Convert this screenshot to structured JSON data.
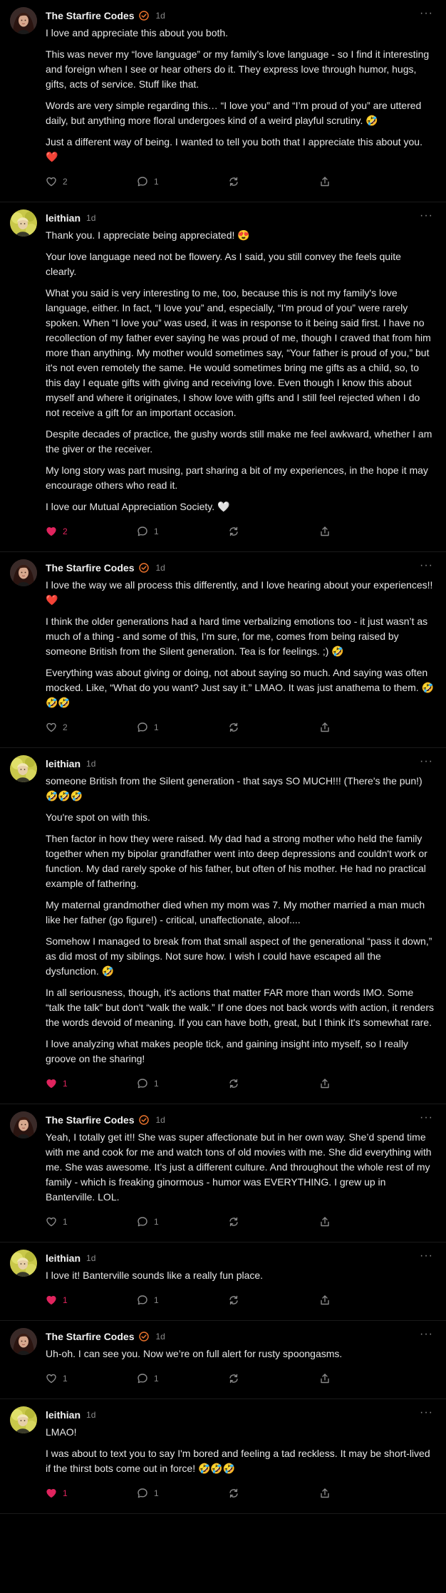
{
  "colors": {
    "background": "#000000",
    "text": "#e6e6e6",
    "muted": "#8a8a8a",
    "like": "#e0245e",
    "verified": "#e8722c"
  },
  "comments": [
    {
      "author": "The Starfire Codes",
      "verified": true,
      "avatar": "starfire",
      "time": "1d",
      "paragraphs": [
        "I love and appreciate this about you both.",
        "This was never my “love language” or my family’s love language - so I find it interesting and foreign when I see or hear others do it. They express love through humor, hugs, gifts, acts of service. Stuff like that.",
        "Words are very simple regarding this… “I love you” and “I’m proud of you” are uttered daily, but anything more floral undergoes kind of a weird playful scrutiny. 🤣",
        "Just a different way of being. I wanted to tell you both that I appreciate this about you. ❤️"
      ],
      "likes": "2",
      "liked": false,
      "replies": "1"
    },
    {
      "author": "leithian",
      "verified": false,
      "avatar": "leithian",
      "time": "1d",
      "paragraphs": [
        "Thank you. I appreciate being appreciated! 😍",
        "Your love language need not be flowery. As I said, you still convey the feels quite clearly.",
        "What you said is very interesting to me, too, because this is not my family's love language, either. In fact, “I love you” and, especially, “I'm proud of you” were rarely spoken. When “I love you” was used, it was in response to it being said first. I have no recollection of my father ever saying he was proud of me, though I craved that from him more than anything. My mother would sometimes say, “Your father is proud of you,” but it's not even remotely the same. He would sometimes bring me gifts as a child, so, to this day I equate gifts with giving and receiving love. Even though I know this about myself and where it originates, I show love with gifts and I still feel rejected when I do not receive a gift for an important occasion.",
        "Despite decades of practice, the gushy words still make me feel awkward, whether I am the giver or the receiver.",
        "My long story was part musing, part sharing a bit of my experiences, in the hope it may encourage others who read it.",
        "I love our Mutual Appreciation Society. 🤍"
      ],
      "likes": "2",
      "liked": true,
      "replies": "1"
    },
    {
      "author": "The Starfire Codes",
      "verified": true,
      "avatar": "starfire",
      "time": "1d",
      "paragraphs": [
        "I love the way we all process this differently, and I love hearing about your experiences!! ❤️",
        "I think the older generations had a hard time verbalizing emotions too - it just wasn’t as much of a thing - and some of this, I’m sure, for me, comes from being raised by someone British from the Silent generation. Tea is for feelings. ;) 🤣",
        "Everything was about giving or doing, not about saying so much. And saying was often mocked. Like, “What do you want? Just say it.” LMAO. It was just anathema to them. 🤣🤣🤣"
      ],
      "likes": "2",
      "liked": false,
      "replies": "1"
    },
    {
      "author": "leithian",
      "verified": false,
      "avatar": "leithian",
      "time": "1d",
      "paragraphs": [
        "someone British from the Silent generation - that says SO MUCH!!! (There's the pun!) 🤣🤣🤣",
        "You're spot on with this.",
        "Then factor in how they were raised. My dad had a strong mother who held the family together when my bipolar grandfather went into deep depressions and couldn't work or function. My dad rarely spoke of his father, but often of his mother. He had no practical example of fathering.",
        "My maternal grandmother died when my mom was 7. My mother married a man much like her father (go figure!) - critical, unaffectionate, aloof....",
        "Somehow I managed to break from that small aspect of the generational “pass it down,” as did most of my siblings. Not sure how. I wish I could have escaped all the dysfunction. 🤣",
        "In all seriousness, though, it's actions that matter FAR more than words IMO. Some “talk the talk” but don't “walk the walk.” If one does not back words with action, it renders the words devoid of meaning. If you can have both, great, but I think it's somewhat rare.",
        "I love analyzing what makes people tick, and gaining insight into myself, so I really groove on the sharing!"
      ],
      "likes": "1",
      "liked": true,
      "replies": "1"
    },
    {
      "author": "The Starfire Codes",
      "verified": true,
      "avatar": "starfire",
      "time": "1d",
      "paragraphs": [
        "Yeah, I totally get it!! She was super affectionate but in her own way. She’d spend time with me and cook for me and watch tons of old movies with me. She did everything with me. She was awesome. It’s just a different culture. And throughout the whole rest of my family - which is freaking ginormous - humor was EVERYTHING. I grew up in Banterville. LOL."
      ],
      "likes": "1",
      "liked": false,
      "replies": "1"
    },
    {
      "author": "leithian",
      "verified": false,
      "avatar": "leithian",
      "time": "1d",
      "paragraphs": [
        "I love it! Banterville sounds like a really fun place."
      ],
      "likes": "1",
      "liked": true,
      "replies": "1"
    },
    {
      "author": "The Starfire Codes",
      "verified": true,
      "avatar": "starfire",
      "time": "1d",
      "paragraphs": [
        "Uh-oh. I can see you. Now we’re on full alert for rusty spoongasms."
      ],
      "likes": "1",
      "liked": false,
      "replies": "1"
    },
    {
      "author": "leithian",
      "verified": false,
      "avatar": "leithian",
      "time": "1d",
      "paragraphs": [
        "LMAO!",
        "I was about to text you to say I'm bored and feeling a tad reckless. It may be short-lived if the thirst bots come out in force! 🤣🤣🤣"
      ],
      "likes": "1",
      "liked": true,
      "replies": "1"
    }
  ]
}
